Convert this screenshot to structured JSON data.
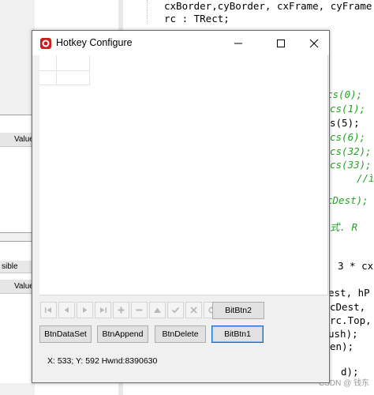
{
  "window": {
    "title": "Hotkey Configure",
    "status_text": "X: 533; Y: 592 Hwnd:8390630"
  },
  "navigator": {
    "buttons": [
      "first",
      "prior",
      "next",
      "last",
      "insert",
      "delete",
      "edit",
      "post",
      "cancel",
      "refresh"
    ]
  },
  "buttons": {
    "bitbtn2": "BitBtn2",
    "dataset": "BtnDataSet",
    "append": "BtnAppend",
    "delete": "BtnDelete",
    "bitbtn1": "BitBtn1"
  },
  "ide": {
    "left_header_1": "Value",
    "left_tab": "sible",
    "left_header_2": "Value",
    "code_lines": [
      "cxBorder,cyBorder, cxFrame, cyFrame,",
      "rc : TRect;"
    ],
    "right_snippets": [
      {
        "text": "cs(0);",
        "style": "green"
      },
      {
        "text": "cs(1);",
        "style": "green"
      },
      {
        "text": "s(5);",
        "style": "black"
      },
      {
        "text": "cs(6);",
        "style": "green"
      },
      {
        "text": "cs(32);",
        "style": "green"
      },
      {
        "text": "cs(33);",
        "style": "green"
      },
      {
        "text": "//ì",
        "style": "green"
      },
      {
        "text": "cDest);",
        "style": "green"
      },
      {
        "text": "式. R",
        "style": "green"
      },
      {
        "text": "3 * cx",
        "style": "black"
      },
      {
        "text": "est, hP",
        "style": "black"
      },
      {
        "text": "cDest,",
        "style": "black"
      },
      {
        "text": "rc.Top,",
        "style": "black"
      },
      {
        "text": "ush);",
        "style": "black"
      },
      {
        "text": "en);",
        "style": "black"
      },
      {
        "text": "d);",
        "style": "black"
      }
    ],
    "watermark": "CSDN @ 钱东"
  }
}
